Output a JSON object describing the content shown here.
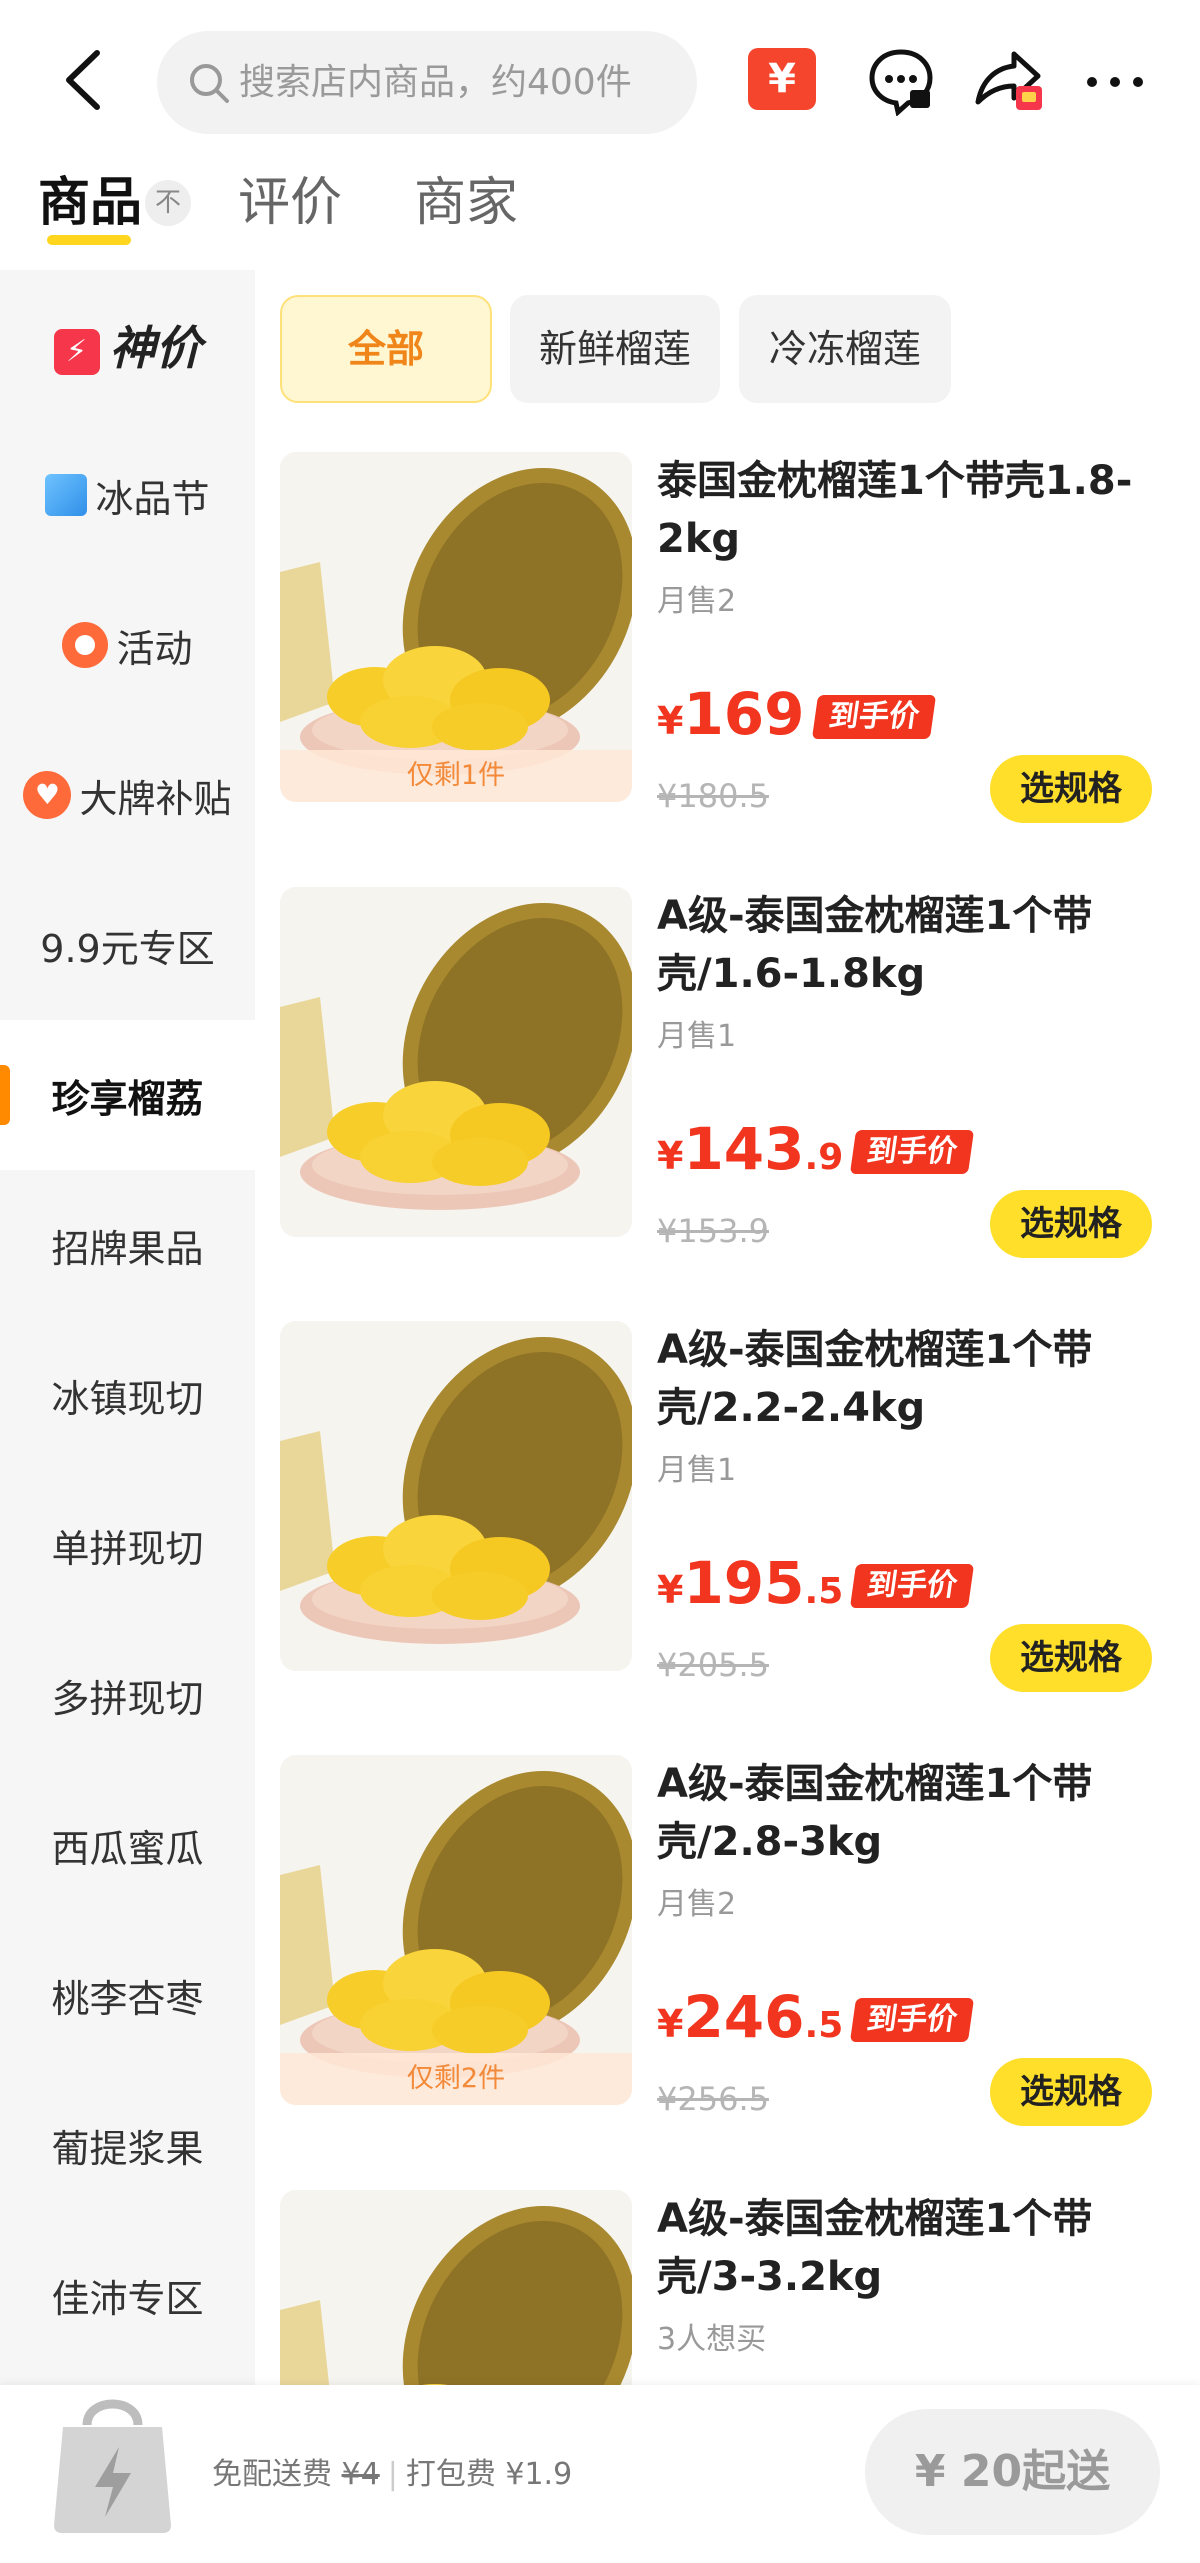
{
  "header": {
    "search_placeholder": "搜索店内商品，约400件",
    "red_packet_symbol": "¥"
  },
  "tabs": [
    {
      "label": "商品"
    },
    {
      "label": "评价"
    },
    {
      "label": "商家"
    }
  ],
  "collapse_symbol": "不",
  "sidebar": {
    "items": [
      {
        "label": "神价",
        "icon": "lightning-badge-icon"
      },
      {
        "label": "冰品节",
        "icon": "ice-cube-icon"
      },
      {
        "label": "活动",
        "icon": "activity-icon"
      },
      {
        "label": "大牌补贴",
        "icon": "heart-badge-icon"
      },
      {
        "label": "9.9元专区"
      },
      {
        "label": "珍享榴荔"
      },
      {
        "label": "招牌果品"
      },
      {
        "label": "冰镇现切"
      },
      {
        "label": "单拼现切"
      },
      {
        "label": "多拼现切"
      },
      {
        "label": "西瓜蜜瓜"
      },
      {
        "label": "桃李杏枣"
      },
      {
        "label": "葡提浆果"
      },
      {
        "label": "佳沛专区"
      }
    ],
    "active_index": 5
  },
  "filters": [
    {
      "label": "全部"
    },
    {
      "label": "新鲜榴莲"
    },
    {
      "label": "冷冻榴莲"
    }
  ],
  "products": [
    {
      "name": "泰国金枕榴莲1个带壳1.8-2kg",
      "sales": "月售2",
      "price_currency": "¥",
      "price_int": "169",
      "price_dec": "",
      "price_tag": "到手价",
      "orig_price": "¥180.5",
      "stock": "仅剩1件",
      "button": "选规格"
    },
    {
      "name": "A级-泰国金枕榴莲1个带壳/1.6-1.8kg",
      "sales": "月售1",
      "price_currency": "¥",
      "price_int": "143",
      "price_dec": ".9",
      "price_tag": "到手价",
      "orig_price": "¥153.9",
      "stock": "",
      "button": "选规格"
    },
    {
      "name": "A级-泰国金枕榴莲1个带壳/2.2-2.4kg",
      "sales": "月售1",
      "price_currency": "¥",
      "price_int": "195",
      "price_dec": ".5",
      "price_tag": "到手价",
      "orig_price": "¥205.5",
      "stock": "",
      "button": "选规格"
    },
    {
      "name": "A级-泰国金枕榴莲1个带壳/2.8-3kg",
      "sales": "月售2",
      "price_currency": "¥",
      "price_int": "246",
      "price_dec": ".5",
      "price_tag": "到手价",
      "orig_price": "¥256.5",
      "stock": "仅剩2件",
      "button": "选规格"
    },
    {
      "name": "A级-泰国金枕榴莲1个带壳/3-3.2kg",
      "sales": "3人想买",
      "price_currency": "",
      "price_int": "",
      "price_dec": "",
      "price_tag": "",
      "orig_price": "",
      "stock": "",
      "button": ""
    }
  ],
  "bottom": {
    "fee_free": "免配送费",
    "fee_free_orig": "¥4",
    "fee_pack": "打包费 ¥1.9",
    "min_order": "¥ 20起送"
  },
  "colors": {
    "accent_yellow": "#ffdf2a",
    "price_red": "#f2351f",
    "active_orange": "#ff8a00"
  }
}
